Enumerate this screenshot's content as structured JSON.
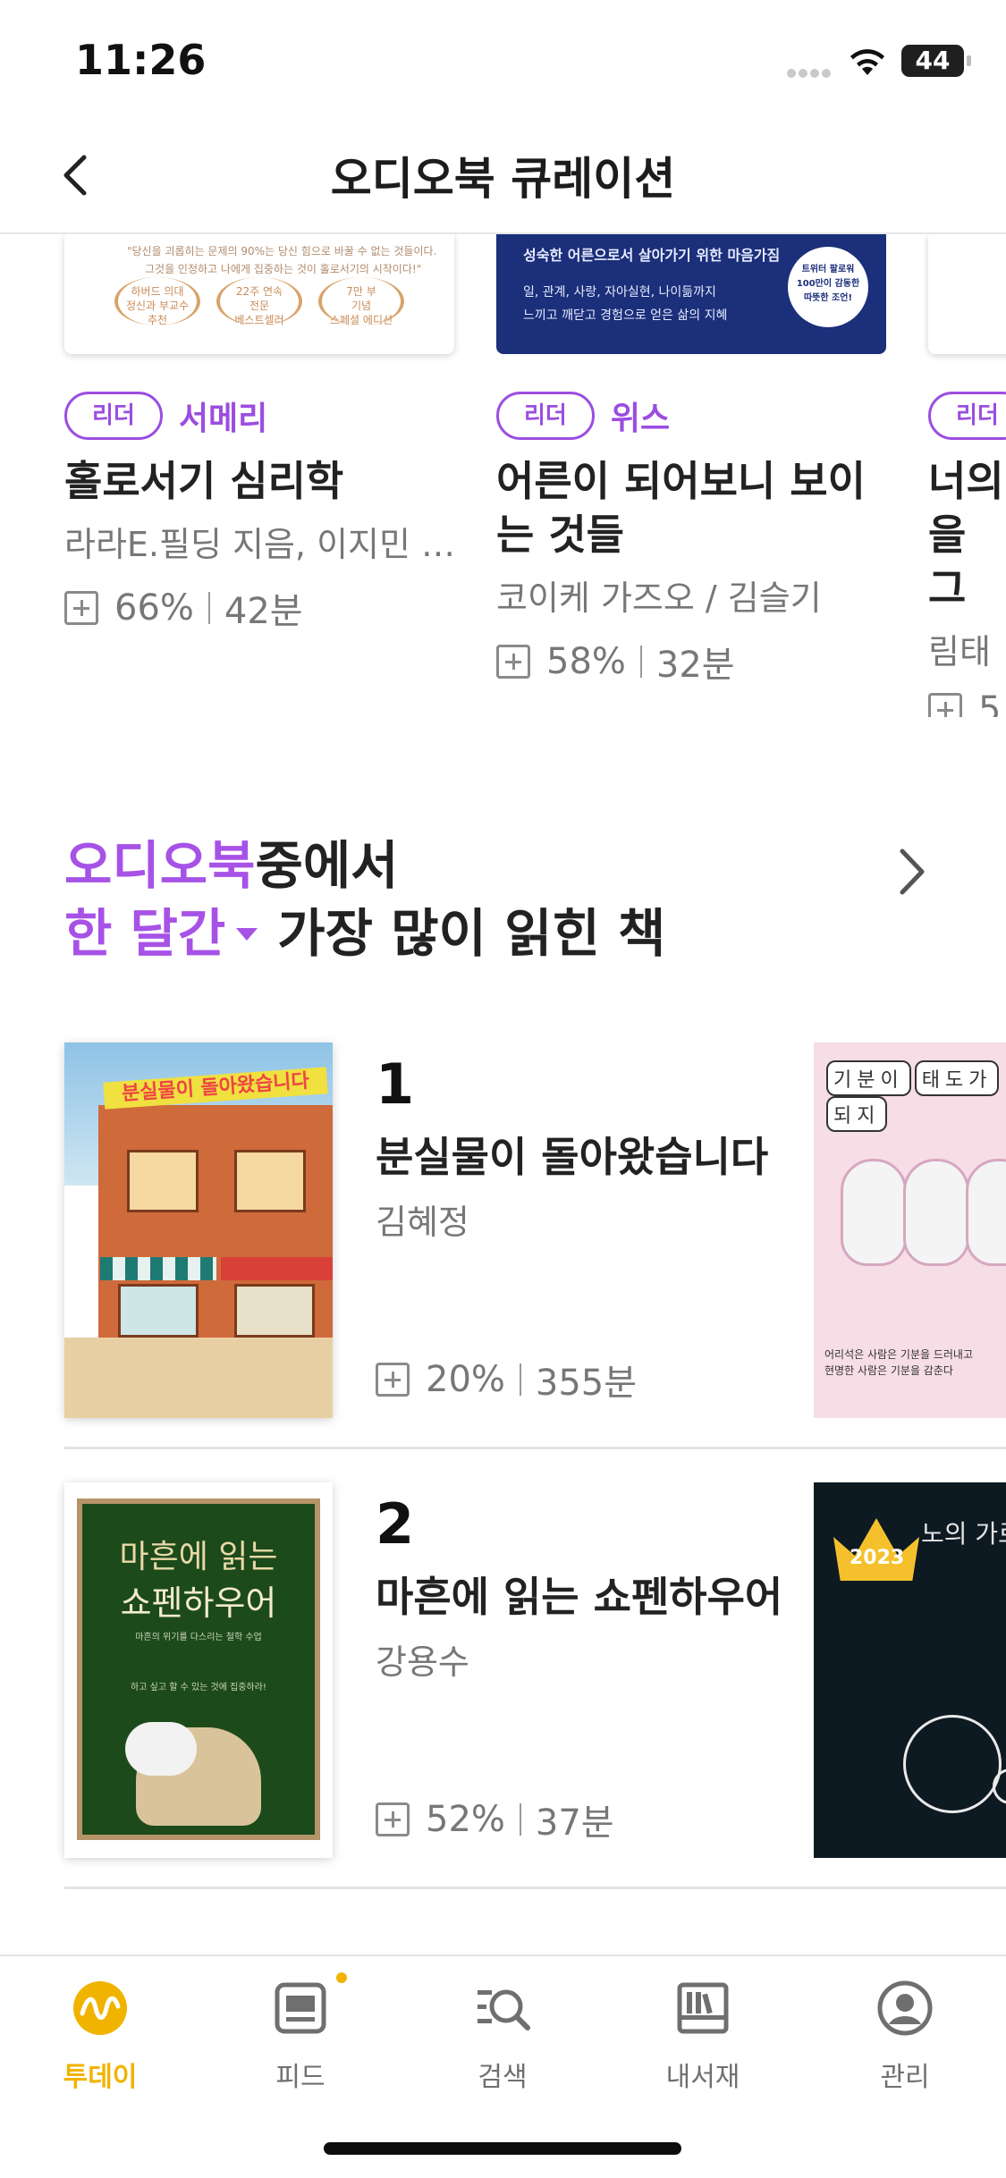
{
  "status": {
    "time": "11:26",
    "battery": "44"
  },
  "nav": {
    "title": "오디오북 큐레이션"
  },
  "top_cards": [
    {
      "leader_label": "리더",
      "leader_name": "서메리",
      "title": "홀로서기 심리학",
      "author": "라라E.필딩 지음, 이지민 …",
      "progress": "66%",
      "duration": "42분"
    },
    {
      "leader_label": "리더",
      "leader_name": "위스",
      "title": "어른이 되어보니 보이는 것들",
      "author": "코이케 가즈오 / 김슬기",
      "progress": "58%",
      "duration": "32분"
    },
    {
      "leader_label": "리더",
      "leader_name": "",
      "title": "너의 을 그",
      "author": "림태",
      "progress": "5",
      "duration": ""
    }
  ],
  "section": {
    "line1_highlight": "오디오북",
    "line1_rest": "중에서",
    "period": "한 달간",
    "line2_rest": "가장 많이 읽힌 책"
  },
  "ranking": [
    {
      "rank": "1",
      "title": "분실물이 돌아왔습니다",
      "author": "김혜정",
      "progress": "20%",
      "duration": "355분",
      "cover_title": "분실물이 돌아왔습니다"
    },
    {
      "rank": "2",
      "title": "마흔에 읽는 쇼펜하우어",
      "author": "강용수",
      "progress": "52%",
      "duration": "37분",
      "cover_title_1": "마흔에 읽는",
      "cover_title_2": "쇼펜하우어"
    }
  ],
  "side_covers": {
    "first_title": [
      "기분이",
      "태도가",
      "되지"
    ],
    "second_year": "2023",
    "second_title": "노의 가르침"
  },
  "tabs": [
    {
      "label": "투데이",
      "icon": "today-icon",
      "active": true
    },
    {
      "label": "피드",
      "icon": "feed-icon",
      "active": false
    },
    {
      "label": "검색",
      "icon": "search-icon",
      "active": false
    },
    {
      "label": "내서재",
      "icon": "library-icon",
      "active": false
    },
    {
      "label": "관리",
      "icon": "profile-icon",
      "active": false
    }
  ],
  "colors": {
    "accent_purple": "#a752e6",
    "accent_yellow": "#f0b400"
  }
}
